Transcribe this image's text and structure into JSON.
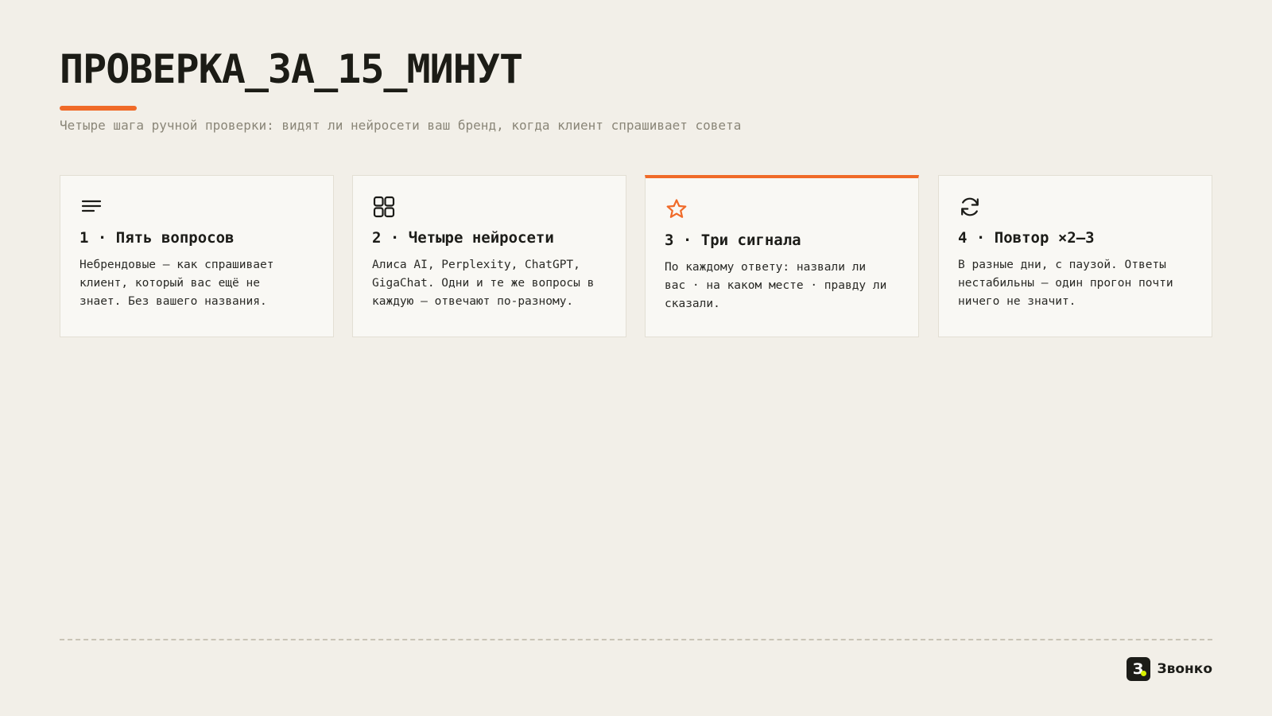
{
  "header": {
    "title": "ПРОВЕРКА_ЗА_15_МИНУТ",
    "subtitle": "Четыре шага ручной проверки: видят ли нейросети ваш бренд, когда клиент спрашивает совета"
  },
  "colors": {
    "accent": "#f06a28",
    "background": "#f2efe8",
    "card": "#f9f8f4",
    "text": "#1c1c18"
  },
  "cards": [
    {
      "icon": "lines-icon",
      "title": "1 · Пять вопросов",
      "text": "Небрендовые — как спрашивает\nклиент, который вас ещё не\nзнает. Без вашего названия."
    },
    {
      "icon": "grid-icon",
      "title": "2 · Четыре нейросети",
      "text": "Алиса AI, Perplexity, ChatGPT,\nGigaChat. Одни и те же вопросы в\nкаждую — отвечают по-разному."
    },
    {
      "icon": "star-icon",
      "title": "3 · Три сигнала",
      "text": "По каждому ответу: назвали ли\nвас · на каком месте · правду ли\nсказали.",
      "highlighted": true
    },
    {
      "icon": "refresh-icon",
      "title": "4 · Повтор ×2–3",
      "text": "В разные дни, с паузой. Ответы\nнестабильны — один прогон почти\nничего не значит."
    }
  ],
  "footer": {
    "brand_logo_letter": "З",
    "brand_name": "Звонко"
  }
}
